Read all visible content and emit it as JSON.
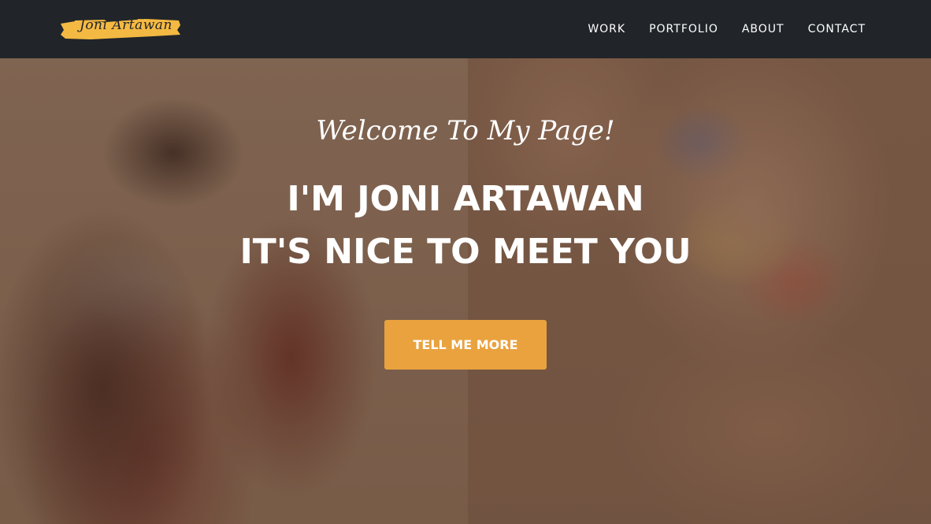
{
  "brand": {
    "logo_text": "Joni Artawan",
    "logo_color": "#F4B942"
  },
  "nav": {
    "items": [
      {
        "label": "WORK"
      },
      {
        "label": "PORTFOLIO"
      },
      {
        "label": "ABOUT"
      },
      {
        "label": "CONTACT"
      }
    ]
  },
  "hero": {
    "subheading": "Welcome To My Page!",
    "heading_line1": "I'M JONI ARTAWAN",
    "heading_line2": "IT'S NICE TO MEET YOU",
    "cta_label": "TELL ME MORE",
    "cta_color": "#E9A23E"
  },
  "colors": {
    "navbar_bg": "#212529",
    "text": "#FFFFFF"
  }
}
